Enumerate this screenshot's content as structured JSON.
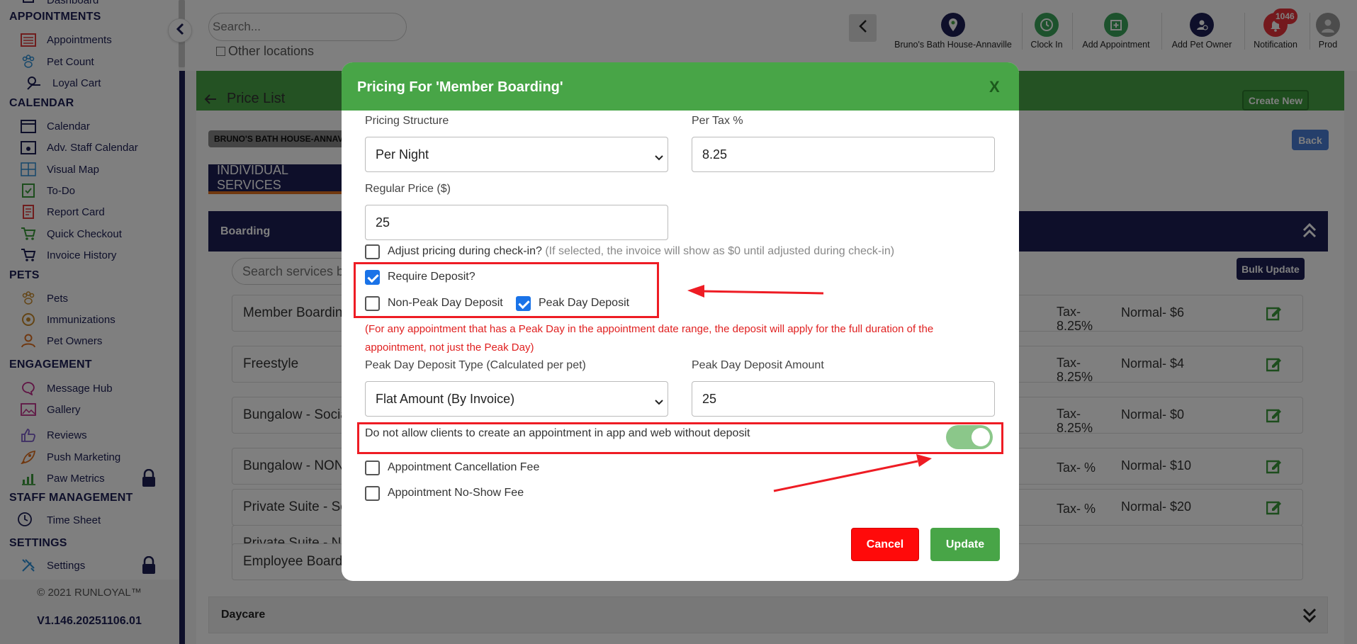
{
  "sidebar": {
    "dashboard_partial": "Dashboard",
    "sections": [
      {
        "title": "APPOINTMENTS",
        "items": [
          "Appointments",
          "Pet Count",
          "Loyal Cart"
        ]
      },
      {
        "title": "CALENDAR",
        "items": [
          "Calendar",
          "Adv. Staff Calendar",
          "Visual Map",
          "To-Do",
          "Report Card",
          "Quick Checkout",
          "Invoice History"
        ]
      },
      {
        "title": "PETS",
        "items": [
          "Pets",
          "Immunizations",
          "Pet Owners"
        ]
      },
      {
        "title": "ENGAGEMENT",
        "items": [
          "Message Hub",
          "Gallery",
          "Reviews",
          "Push Marketing",
          "Paw Metrics"
        ]
      },
      {
        "title": "STAFF MANAGEMENT",
        "items": [
          "Time Sheet"
        ]
      },
      {
        "title": "SETTINGS",
        "items": [
          "Settings"
        ]
      }
    ],
    "copyright": "© 2021  RUNLOYAL™",
    "version": "V1.146.20251106.01"
  },
  "topbar": {
    "search_placeholder": "Search...",
    "other_locations": "Other locations",
    "location_name": "Bruno's Bath House-Annaville",
    "clock_in": "Clock In",
    "add_appointment": "Add Appointment",
    "add_pet_owner": "Add Pet Owner",
    "notification": "Notification",
    "notification_count": "1046",
    "profile": "Prod"
  },
  "page": {
    "title": "Price List",
    "create_new": "Create New",
    "back": "Back",
    "location_badge": "BRUNO'S BATH HOUSE-ANNAVILLE",
    "tab": "INDIVIDUAL SERVICES",
    "boarding_header": "Boarding",
    "search_services_placeholder": "Search services by",
    "bulk_update": "Bulk Update",
    "services": [
      {
        "name": "Member Boarding",
        "tax": "Tax-\n8.25%",
        "price": "Normal- $6"
      },
      {
        "name": "Freestyle",
        "tax": "Tax-\n8.25%",
        "price": "Normal- $4"
      },
      {
        "name": "Bungalow - Social",
        "tax": "Tax-\n8.25%",
        "price": "Normal- $0"
      },
      {
        "name": "Bungalow - NON",
        "tax": "Tax- %",
        "price": "Normal- $10"
      },
      {
        "name": "Private Suite - So",
        "tax": "Tax- %",
        "price": "Normal- $20"
      },
      {
        "name": "Private Suite - NO",
        "tax": "",
        "price": ""
      },
      {
        "name": "Employee Board",
        "tax": "",
        "price": ""
      }
    ],
    "daycare_header": "Daycare"
  },
  "modal": {
    "title": "Pricing For 'Member Boarding'",
    "close": "X",
    "pricing_structure_label": "Pricing Structure",
    "pricing_structure_value": "Per Night",
    "per_tax_label": "Per Tax %",
    "per_tax_value": "8.25",
    "regular_price_label": "Regular Price ($)",
    "regular_price_value": "25",
    "adjust_label": "Adjust pricing during check-in?",
    "adjust_hint": "(If selected, the invoice will show as $0 until adjusted during check-in)",
    "require_deposit_label": "Require Deposit?",
    "non_peak_label": "Non-Peak Day Deposit",
    "peak_label": "Peak Day Deposit",
    "warning_line1": "(For any appointment that has a Peak Day in the appointment date range, the deposit will apply for the full duration of the",
    "warning_line2": "appointment, not just the Peak Day)",
    "deposit_type_label": "Peak Day Deposit Type (Calculated per pet)",
    "deposit_type_value": "Flat Amount (By Invoice)",
    "deposit_amount_label": "Peak Day Deposit Amount",
    "deposit_amount_value": "25",
    "no_deposit_toggle_label": "Do not allow clients to create an appointment in app and web without deposit",
    "cancel_fee_label": "Appointment Cancellation Fee",
    "noshow_fee_label": "Appointment No-Show Fee",
    "cancel": "Cancel",
    "update": "Update"
  },
  "colors": {
    "brand_green": "#48a547",
    "navy": "#1c1f55",
    "cancel_red": "#ff0a0a",
    "annotation_red": "#ee1c24",
    "checkbox_blue": "#1a73e8"
  }
}
